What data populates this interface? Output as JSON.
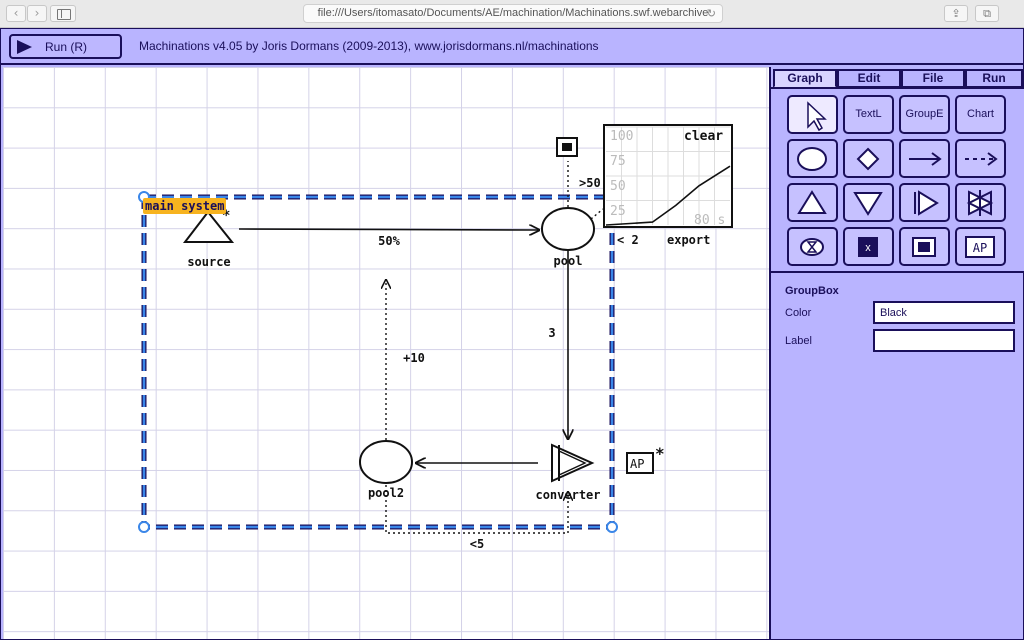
{
  "browser": {
    "back_glyph": "‹",
    "forward_glyph": "›",
    "url": "file:///Users/itomasato/Documents/AE/machination/Machinations.swf.webarchive",
    "reload_glyph": "↻",
    "share_glyph": "⇪",
    "tabs_glyph": "⧉"
  },
  "app": {
    "run_label": "Run (R)",
    "title": "Machinations v4.05 by Joris Dormans (2009-2013), www.jorisdormans.nl/machinations"
  },
  "tabs": [
    {
      "label": "Graph",
      "active": true
    },
    {
      "label": "Edit",
      "active": false
    },
    {
      "label": "File",
      "active": false
    },
    {
      "label": "Run",
      "active": false
    }
  ],
  "tools": {
    "text": "TextL",
    "group": "GroupE",
    "chart": "Chart",
    "register_x": "x",
    "ap": "AP"
  },
  "properties": {
    "title": "GroupBox",
    "color_label": "Color",
    "color_value": "Black",
    "label_label": "Label",
    "label_value": ""
  },
  "diagram": {
    "group_label": "main system",
    "source_label": "source",
    "source_star": "*",
    "pool_label": "pool",
    "pool2_label": "pool2",
    "converter_label": "converter",
    "edge_source_pool": "50%",
    "edge_pool_converter": "3",
    "edge_pool2_group": "+10",
    "edge_converter_pool2": "<5",
    "trigger_gt": ">50",
    "export_count": "< 2",
    "export_label": "export",
    "ap_label": "AP",
    "ap_star": "*",
    "chart": {
      "clear": "clear",
      "y_ticks": [
        "100",
        "75",
        "50",
        "25"
      ],
      "x_label": "80 s"
    }
  },
  "chart_data": {
    "type": "line",
    "x": [
      0,
      30,
      45,
      60,
      80
    ],
    "y": [
      0,
      3,
      20,
      40,
      60
    ],
    "ylim": [
      0,
      100
    ],
    "xlim": [
      0,
      80
    ],
    "y_ticks": [
      25,
      50,
      75,
      100
    ],
    "grid": true
  }
}
